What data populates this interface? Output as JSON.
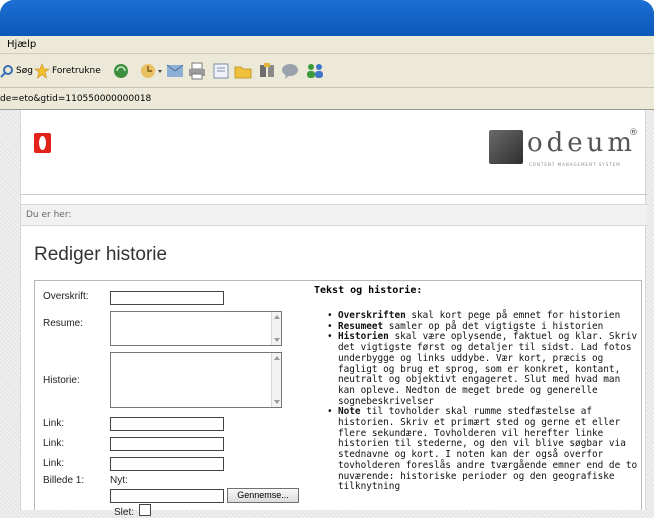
{
  "menu": {
    "help": "Hjælp"
  },
  "toolbar": {
    "search": "Søg",
    "favorites": "Foretrukne"
  },
  "address": {
    "url": "de=eto&gtid=110550000000018"
  },
  "page": {
    "breadcrumb": "Du er her:",
    "title": "Rediger historie",
    "logo": {
      "word": "odeum",
      "reg": "®",
      "tagline": "CONTENT MANAGEMENT SYSTEM"
    }
  },
  "form": {
    "headline_label": "Overskrift:",
    "summary_label": "Resume:",
    "story_label": "Historie:",
    "link_label": "Link:",
    "image_label": "Billede 1:",
    "new_label": "Nyt:",
    "browse_button": "Gennemse...",
    "delete_label": "Slet:"
  },
  "help": {
    "title": "Tekst og historie:",
    "items": [
      {
        "term": "Overskriften",
        "text": " skal kort pege på emnet for historien"
      },
      {
        "term": "Resumeet",
        "text": " samler op på det vigtigste i historien"
      },
      {
        "term": "Historien",
        "text": " skal være oplysende, faktuel og klar. Skriv det vigtigste først og detaljer til sidst. Lad fotos underbygge og links uddybe. Vær kort, præcis og fagligt og brug et sprog, som er konkret, kontant, neutralt og objektivt engageret. Slut med hvad man kan opleve. Nedton de meget brede og generelle sognebeskrivelser"
      },
      {
        "term": "Note",
        "text": " til tovholder skal rumme stedfæstelse af historien. Skriv et primært sted og gerne et eller flere sekundære. Tovholderen vil herefter linke historien til stederne, og den vil blive søgbar via stednavne og kort. I noten kan der også overfor tovholderen foreslås andre tværgående emner end de to nuværende: historiske perioder og den geografiske tilknytning"
      }
    ]
  },
  "colors": {
    "window_blue": "#0b58b8",
    "logo_red": "#e2231a"
  }
}
